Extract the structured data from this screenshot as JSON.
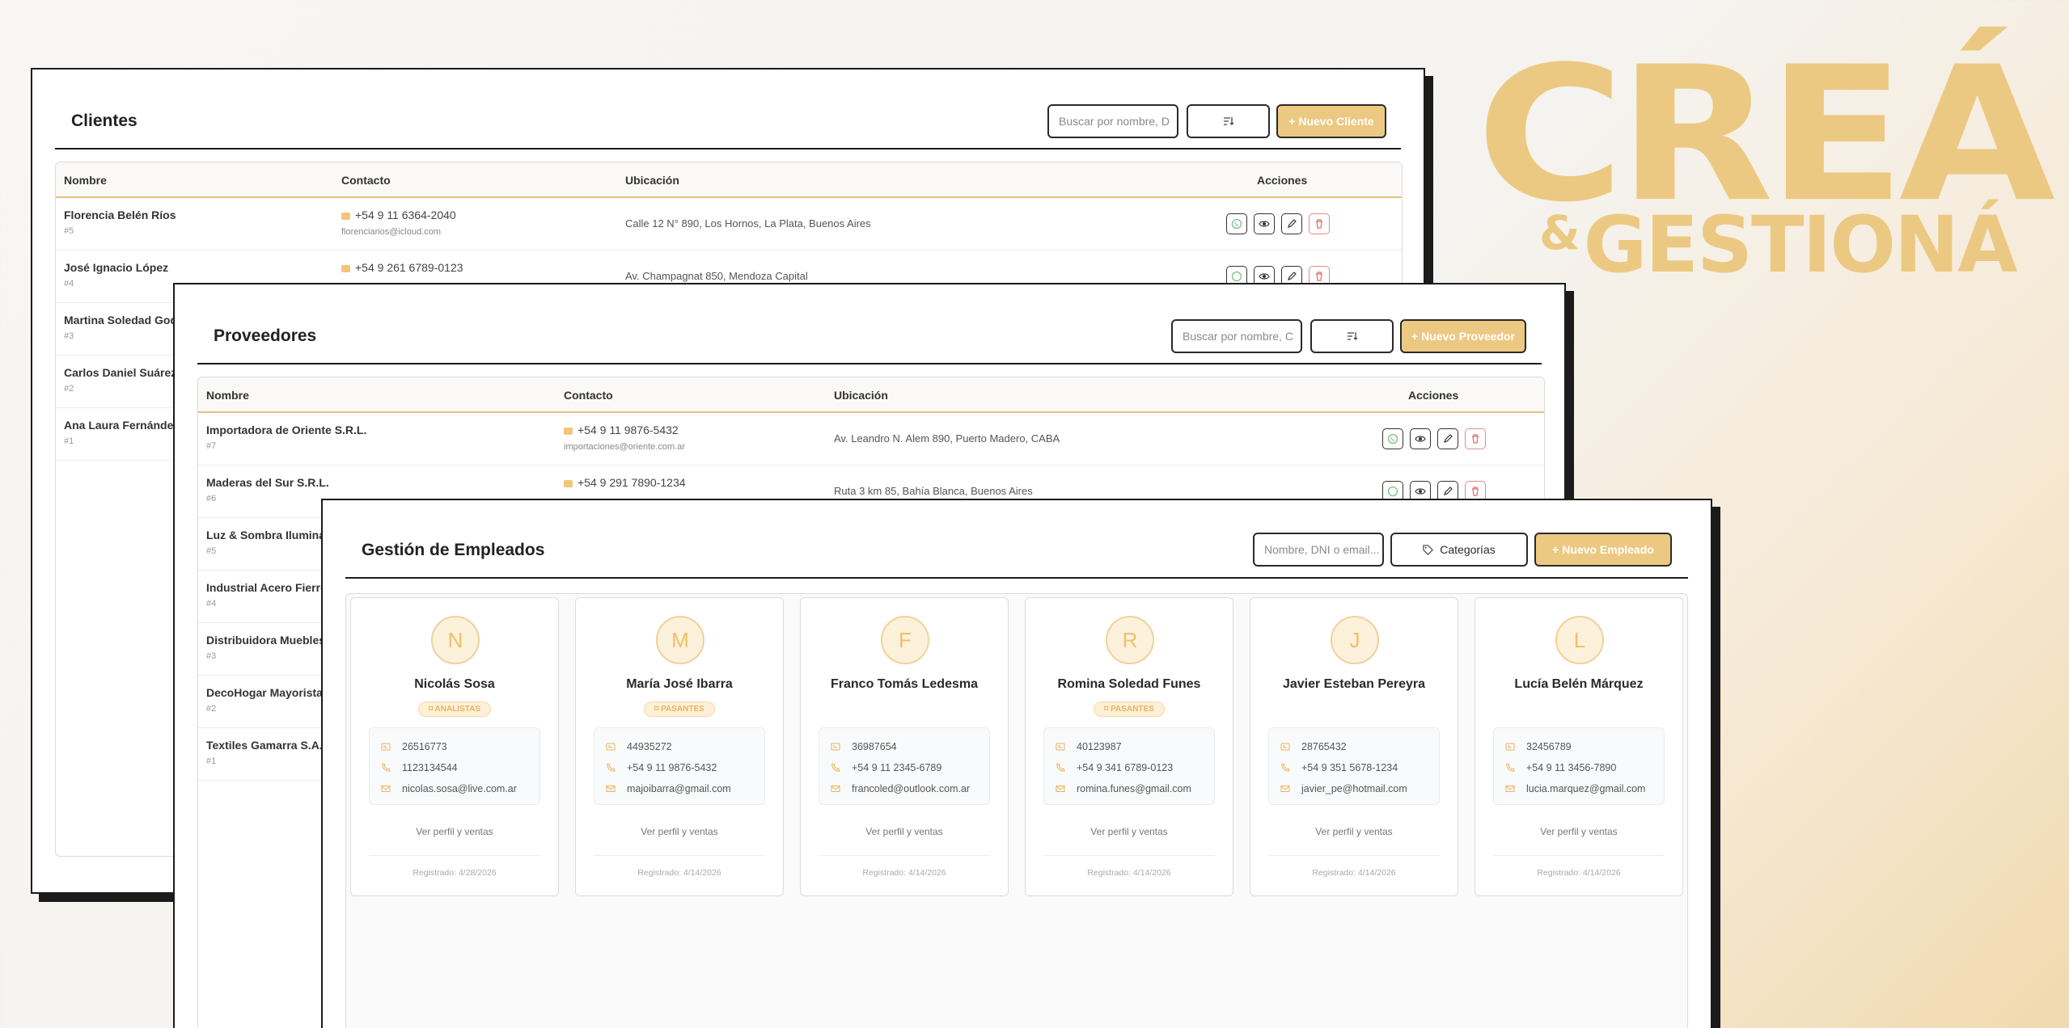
{
  "hero": {
    "line1": "CREÁ",
    "amp": "&",
    "line2": "GESTIONÁ"
  },
  "colors": {
    "accent": "#ecc982",
    "border": "#1b1b1b"
  },
  "clientes": {
    "title": "Clientes",
    "search_placeholder": "Buscar por nombre, D",
    "new_label": "+ Nuevo Cliente",
    "columns": [
      "Nombre",
      "Contacto",
      "Ubicación",
      "Acciones"
    ],
    "rows": [
      {
        "name": "Florencia Belén Ríos",
        "id": "#5",
        "phone": "+54 9 11 6364-2040",
        "email": "florenciarios@icloud.com",
        "location": "Calle 12 N° 890, Los Hornos, La Plata, Buenos Aires"
      },
      {
        "name": "José Ignacio López",
        "id": "#4",
        "phone": "+54 9 261 6789-0123",
        "email": "",
        "location": "Av. Champagnat 850, Mendoza Capital"
      },
      {
        "name": "Martina Soledad Godoy",
        "id": "#3"
      },
      {
        "name": "Carlos Daniel Suárez",
        "id": "#2"
      },
      {
        "name": "Ana Laura Fernández",
        "id": "#1"
      }
    ]
  },
  "proveedores": {
    "title": "Proveedores",
    "search_placeholder": "Buscar por nombre, C",
    "new_label": "+ Nuevo Proveedor",
    "columns": [
      "Nombre",
      "Contacto",
      "Ubicación",
      "Acciones"
    ],
    "rows": [
      {
        "name": "Importadora de Oriente S.R.L.",
        "id": "#7",
        "phone": "+54 9 11 9876-5432",
        "email": "importaciones@oriente.com.ar",
        "location": "Av. Leandro N. Alem 890, Puerto Madero, CABA"
      },
      {
        "name": "Maderas del Sur S.R.L.",
        "id": "#6",
        "phone": "+54 9 291 7890-1234",
        "email": "",
        "location": "Ruta 3 km 85, Bahía Blanca, Buenos Aires"
      },
      {
        "name": "Luz & Sombra Iluminación",
        "id": "#5"
      },
      {
        "name": "Industrial Acero Fierro",
        "id": "#4"
      },
      {
        "name": "Distribuidora Muebles",
        "id": "#3"
      },
      {
        "name": "DecoHogar Mayorista",
        "id": "#2"
      },
      {
        "name": "Textiles Gamarra S.A.",
        "id": "#1"
      }
    ]
  },
  "empleados": {
    "title": "Gestión de Empleados",
    "search_placeholder": "Nombre, DNI o email...",
    "categories_label": "Categorías",
    "new_label": "+ Nuevo Empleado",
    "link_label": "Ver perfil y ventas",
    "cards": [
      {
        "initial": "N",
        "name": "Nicolás Sosa",
        "tag": "ANALISTAS",
        "dni": "26516773",
        "phone": "1123134544",
        "email": "nicolas.sosa@live.com.ar",
        "registered": "Registrado: 4/28/2026"
      },
      {
        "initial": "M",
        "name": "María José Ibarra",
        "tag": "PASANTES",
        "dni": "44935272",
        "phone": "+54 9 11 9876-5432",
        "email": "majoibarra@gmail.com",
        "registered": "Registrado: 4/14/2026"
      },
      {
        "initial": "F",
        "name": "Franco Tomás Ledesma",
        "tag": "",
        "dni": "36987654",
        "phone": "+54 9 11 2345-6789",
        "email": "francoled@outlook.com.ar",
        "registered": "Registrado: 4/14/2026"
      },
      {
        "initial": "R",
        "name": "Romina Soledad Funes",
        "tag": "PASANTES",
        "dni": "40123987",
        "phone": "+54 9 341 6789-0123",
        "email": "romina.funes@gmail.com",
        "registered": "Registrado: 4/14/2026"
      },
      {
        "initial": "J",
        "name": "Javier Esteban Pereyra",
        "tag": "",
        "dni": "28765432",
        "phone": "+54 9 351 5678-1234",
        "email": "javier_pe@hotmail.com",
        "registered": "Registrado: 4/14/2026"
      },
      {
        "initial": "L",
        "name": "Lucía Belén Márquez",
        "tag": "",
        "dni": "32456789",
        "phone": "+54 9 11 3456-7890",
        "email": "lucia.marquez@gmail.com",
        "registered": "Registrado: 4/14/2026"
      }
    ]
  }
}
